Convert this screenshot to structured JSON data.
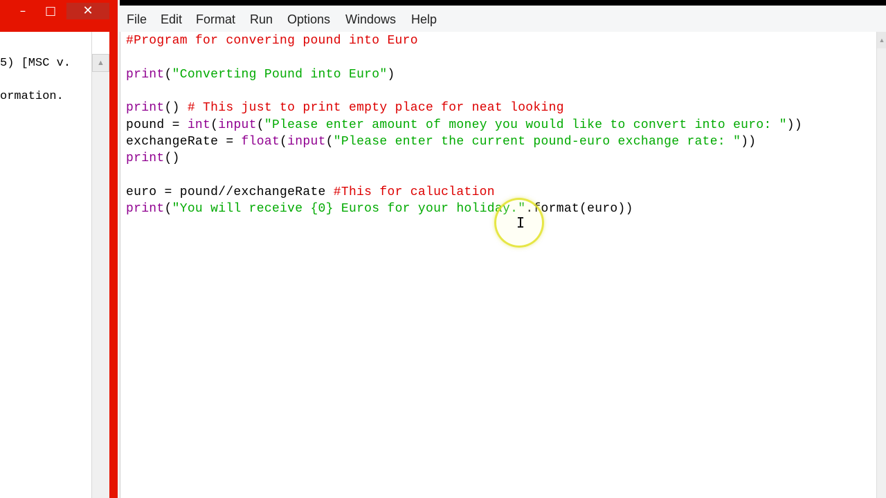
{
  "shell": {
    "title_buttons": {
      "minimize": "–",
      "maximize": "□",
      "close": "✕"
    },
    "lines": [
      "5) [MSC v.",
      "ormation."
    ],
    "scroll_up": "▲"
  },
  "editor": {
    "menu": [
      "File",
      "Edit",
      "Format",
      "Run",
      "Options",
      "Windows",
      "Help"
    ],
    "code": [
      {
        "segments": [
          {
            "text": "#Program for convering pound into Euro",
            "kind": "comment"
          }
        ]
      },
      {
        "segments": []
      },
      {
        "segments": [
          {
            "text": "print",
            "kind": "builtin"
          },
          {
            "text": "(",
            "kind": "default"
          },
          {
            "text": "\"Converting Pound into Euro\"",
            "kind": "string"
          },
          {
            "text": ")",
            "kind": "default"
          }
        ]
      },
      {
        "segments": []
      },
      {
        "segments": [
          {
            "text": "print",
            "kind": "builtin"
          },
          {
            "text": "() ",
            "kind": "default"
          },
          {
            "text": "# This just to print empty place for neat looking",
            "kind": "comment"
          }
        ]
      },
      {
        "segments": [
          {
            "text": "pound = ",
            "kind": "default"
          },
          {
            "text": "int",
            "kind": "builtin"
          },
          {
            "text": "(",
            "kind": "default"
          },
          {
            "text": "input",
            "kind": "builtin"
          },
          {
            "text": "(",
            "kind": "default"
          },
          {
            "text": "\"Please enter amount of money you would like to convert into euro: \"",
            "kind": "string"
          },
          {
            "text": "))",
            "kind": "default"
          }
        ]
      },
      {
        "segments": [
          {
            "text": "exchangeRate = ",
            "kind": "default"
          },
          {
            "text": "float",
            "kind": "builtin"
          },
          {
            "text": "(",
            "kind": "default"
          },
          {
            "text": "input",
            "kind": "builtin"
          },
          {
            "text": "(",
            "kind": "default"
          },
          {
            "text": "\"Please enter the current pound-euro exchange rate: \"",
            "kind": "string"
          },
          {
            "text": "))",
            "kind": "default"
          }
        ]
      },
      {
        "segments": [
          {
            "text": "print",
            "kind": "builtin"
          },
          {
            "text": "()",
            "kind": "default"
          }
        ]
      },
      {
        "segments": []
      },
      {
        "segments": [
          {
            "text": "euro = pound//exchangeRate ",
            "kind": "default"
          },
          {
            "text": "#This for caluclation",
            "kind": "comment"
          }
        ]
      },
      {
        "segments": [
          {
            "text": "print",
            "kind": "builtin"
          },
          {
            "text": "(",
            "kind": "default"
          },
          {
            "text": "\"You will receive {0} Euros for your holiday.\"",
            "kind": "string"
          },
          {
            "text": ".format(euro))",
            "kind": "default"
          }
        ]
      }
    ],
    "scroll_up": "▲"
  },
  "pointer": {
    "glyph": "I"
  },
  "colors": {
    "title_red": "#e51400",
    "comment": "#dd0000",
    "string": "#00aa00",
    "builtin": "#900090",
    "default": "#000000"
  }
}
